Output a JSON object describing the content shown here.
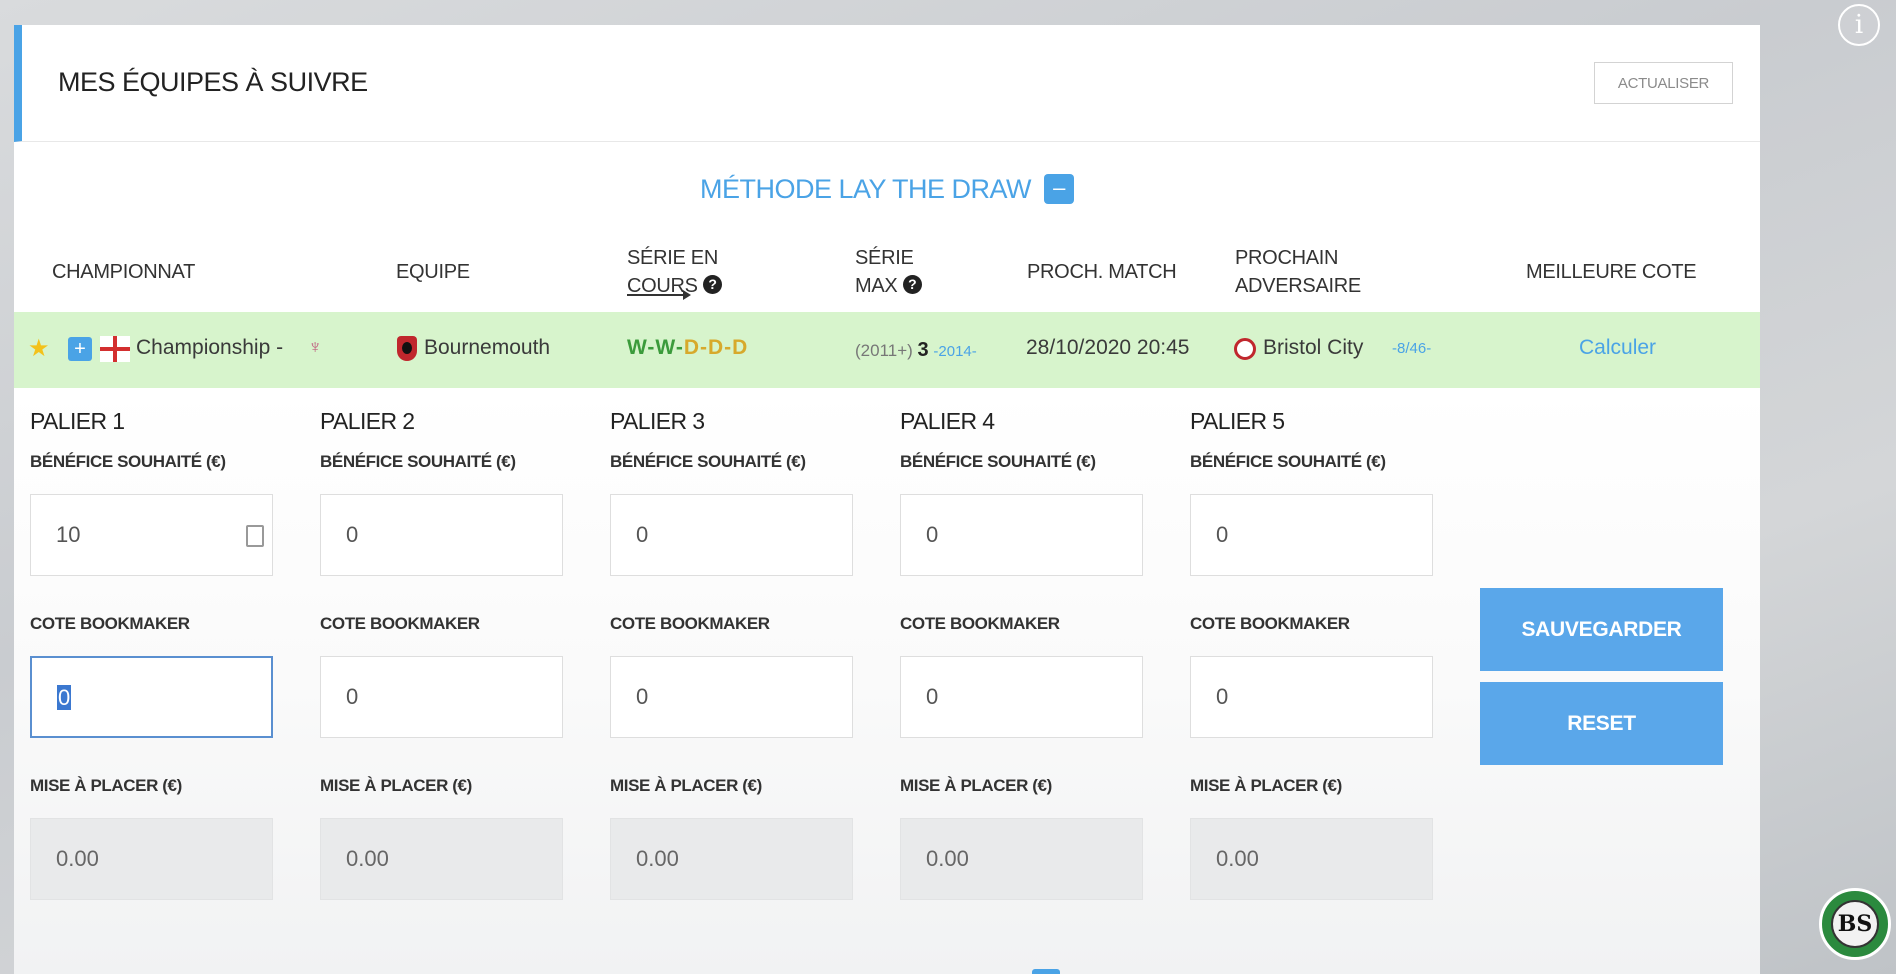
{
  "header": {
    "title": "MES ÉQUIPES À SUIVRE",
    "refresh_label": "ACTUALISER"
  },
  "method": {
    "title": "MÉTHODE LAY THE DRAW",
    "toggle_symbol": "–"
  },
  "columns": {
    "championnat": "CHAMPIONNAT",
    "equipe": "EQUIPE",
    "serie_en_cours_l1": "SÉRIE EN",
    "serie_en_cours_l2": "COURS",
    "serie_max_l1": "SÉRIE",
    "serie_max_l2": "MAX",
    "proch_match": "PROCH. MATCH",
    "prochain_adversaire_l1": "PROCHAIN",
    "prochain_adversaire_l2": "ADVERSAIRE",
    "meilleure_cote": "MEILLEURE COTE",
    "help_symbol": "?"
  },
  "team_row": {
    "star": "★",
    "expand": "+",
    "league": "Championship -",
    "cup_icon": "♆",
    "team": "Bournemouth",
    "form": [
      "W",
      "-",
      "W",
      "-",
      "D",
      "-",
      "D",
      "-",
      "D"
    ],
    "serie_max_prefix": "(2011+)",
    "serie_max_value": "3",
    "serie_max_year": "-2014-",
    "next_match": "28/10/2020 20:45",
    "opponent": "Bristol City",
    "opponent_rank": "-8/46-",
    "best_odds_link": "Calculer"
  },
  "labels": {
    "benefice": "BÉNÉFICE SOUHAITÉ (€)",
    "cote": "COTE BOOKMAKER",
    "mise": "MISE À PLACER (€)"
  },
  "tiers": [
    {
      "title": "PALIER 1",
      "benefice": "10",
      "cote": "0",
      "mise": "0.00"
    },
    {
      "title": "PALIER 2",
      "benefice": "0",
      "cote": "0",
      "mise": "0.00"
    },
    {
      "title": "PALIER 3",
      "benefice": "0",
      "cote": "0",
      "mise": "0.00"
    },
    {
      "title": "PALIER 4",
      "benefice": "0",
      "cote": "0",
      "mise": "0.00"
    },
    {
      "title": "PALIER 5",
      "benefice": "0",
      "cote": "0",
      "mise": "0.00"
    }
  ],
  "actions": {
    "save": "SAUVEGARDER",
    "reset": "RESET"
  },
  "misc": {
    "info_symbol": "i",
    "logo_text": "BS"
  },
  "colors": {
    "accent": "#4aa3e6",
    "row_highlight": "#d7f4cc",
    "win": "#3b9b3b",
    "draw": "#d7a92c"
  }
}
